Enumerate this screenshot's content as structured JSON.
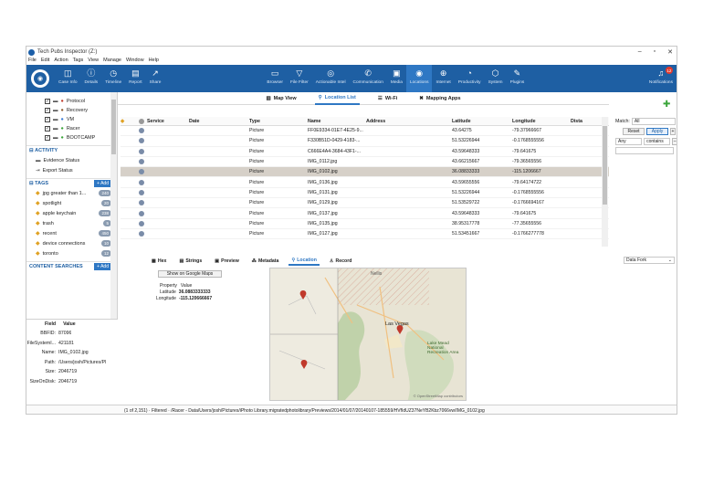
{
  "window": {
    "title": "Tech Pubs Inspector (Z:)"
  },
  "menu": [
    "File",
    "Edit",
    "Action",
    "Tags",
    "View",
    "Manage",
    "Window",
    "Help"
  ],
  "ribbon": {
    "left": [
      {
        "label": "Case Info",
        "icon": "case-info-icon",
        "glyph": "◫"
      },
      {
        "label": "Details",
        "icon": "details-icon",
        "glyph": "ⓘ"
      },
      {
        "label": "Timeline",
        "icon": "timeline-icon",
        "glyph": "◷"
      },
      {
        "label": "Report",
        "icon": "report-icon",
        "glyph": "▤"
      },
      {
        "label": "Share",
        "icon": "share-icon",
        "glyph": "↗"
      }
    ],
    "center": [
      {
        "label": "Browser",
        "icon": "browser-icon",
        "glyph": "▭"
      },
      {
        "label": "File Filter",
        "icon": "file-filter-icon",
        "glyph": "▽"
      },
      {
        "label": "Actionable Intel",
        "icon": "actionable-intel-icon",
        "glyph": "◎"
      },
      {
        "label": "Communication",
        "icon": "communication-icon",
        "glyph": "✆"
      },
      {
        "label": "Media",
        "icon": "media-icon",
        "glyph": "▣"
      },
      {
        "label": "Locations",
        "icon": "locations-icon",
        "glyph": "◉",
        "active": true
      },
      {
        "label": "Internet",
        "icon": "internet-icon",
        "glyph": "⊕"
      },
      {
        "label": "Productivity",
        "icon": "productivity-icon",
        "glyph": "◔"
      },
      {
        "label": "System",
        "icon": "system-icon",
        "glyph": "⬡"
      },
      {
        "label": "Plugins",
        "icon": "plugins-icon",
        "glyph": "✎"
      }
    ],
    "notifications": {
      "label": "Notifications",
      "count": "12"
    }
  },
  "left_tree": [
    {
      "label": "Protocol",
      "checked": true
    },
    {
      "label": "Recovery",
      "checked": true
    },
    {
      "label": "VM",
      "checked": true
    },
    {
      "label": "Racer",
      "checked": true
    },
    {
      "label": "BOOTCAMP",
      "checked": true
    }
  ],
  "activity": {
    "title": "ACTIVITY",
    "items": [
      "Evidence Status",
      "Export Status"
    ]
  },
  "tags": {
    "title": "TAGS",
    "add": "+ Add",
    "items": [
      {
        "label": "jpg greater than 1...",
        "count": "240"
      },
      {
        "label": "spotlight",
        "count": "20"
      },
      {
        "label": "apple keychain",
        "count": "238"
      },
      {
        "label": "trash",
        "count": "5"
      },
      {
        "label": "recent",
        "count": "450"
      },
      {
        "label": "device connections",
        "count": "10"
      },
      {
        "label": "toronto",
        "count": "12"
      }
    ]
  },
  "content_searches": {
    "title": "CONTENT SEARCHES",
    "add": "+ Add"
  },
  "props": {
    "headers": [
      "Field",
      "Value"
    ],
    "rows": [
      {
        "field": "BBFID:",
        "value": "87096"
      },
      {
        "field": "FileSystemI...",
        "value": "421181"
      },
      {
        "field": "Name:",
        "value": "IMG_0102.jpg"
      },
      {
        "field": "Path:",
        "value": "/Users/josh/Pictures/Pl"
      },
      {
        "field": "Size:",
        "value": "2046719"
      },
      {
        "field": "SizeOnDisk:",
        "value": "2046719"
      }
    ]
  },
  "view_tabs": [
    {
      "label": "Map View",
      "active": false
    },
    {
      "label": "Location List",
      "active": true
    },
    {
      "label": "Wi-Fi",
      "active": false
    },
    {
      "label": "Mapping Apps",
      "active": false
    }
  ],
  "grid": {
    "headers": [
      "Service",
      "Date",
      "Type",
      "Name",
      "Address",
      "Latitude",
      "Longitude",
      "Dista"
    ],
    "rows": [
      {
        "type": "Picture",
        "name": "FF0E9334-01E7-4E25-9...",
        "lat": "43.64275",
        "lon": "-79.37966667"
      },
      {
        "type": "Picture",
        "name": "F330B51D-0429-4183-...",
        "lat": "51.53226944",
        "lon": "-0.1768555556"
      },
      {
        "type": "Picture",
        "name": "C666E4A4-3684-43F1-...",
        "lat": "43.59648333",
        "lon": "-79.641675"
      },
      {
        "type": "Picture",
        "name": "IMG_0112.jpg",
        "lat": "43.66215667",
        "lon": "-79.36565556"
      },
      {
        "type": "Picture",
        "name": "IMG_0102.jpg",
        "lat": "36.08833333",
        "lon": "-115.1206667",
        "selected": true
      },
      {
        "type": "Picture",
        "name": "IMG_0136.jpg",
        "lat": "43.59655556",
        "lon": "-79.64174722"
      },
      {
        "type": "Picture",
        "name": "IMG_0131.jpg",
        "lat": "51.53226944",
        "lon": "-0.1768555556"
      },
      {
        "type": "Picture",
        "name": "IMG_0129.jpg",
        "lat": "51.53529722",
        "lon": "-0.1766694167"
      },
      {
        "type": "Picture",
        "name": "IMG_0137.jpg",
        "lat": "43.59648333",
        "lon": "-79.641675"
      },
      {
        "type": "Picture",
        "name": "IMG_0135.jpg",
        "lat": "38.95317778",
        "lon": "-77.35655556"
      },
      {
        "type": "Picture",
        "name": "IMG_0127.jpg",
        "lat": "51.53451667",
        "lon": "-0.1766277778"
      }
    ]
  },
  "filter": {
    "match_label": "Match:",
    "match_value": "All",
    "reset": "Reset",
    "apply": "Apply",
    "any": "Any",
    "contains": "contains"
  },
  "lower_tabs": [
    {
      "label": "Hex",
      "active": false
    },
    {
      "label": "Strings",
      "active": false
    },
    {
      "label": "Preview",
      "active": false
    },
    {
      "label": "Metadata",
      "active": false
    },
    {
      "label": "Location",
      "active": true
    },
    {
      "label": "Record",
      "active": false
    }
  ],
  "fork": "Data Fork",
  "location": {
    "show_button": "Show on Google Maps",
    "headers": [
      "Property",
      "Value"
    ],
    "latitude_label": "Latitude",
    "latitude": "36.0883333333",
    "longitude_label": "Longitude",
    "longitude": "-115.120666667"
  },
  "map_labels": {
    "city": "Las Vegas",
    "nellis": "Nellis",
    "lake_mead": "Lake Mead National Recreation Area",
    "attribution": "© OpenStreetMap contributors"
  },
  "status": "(1 of 2,151) · Filtered · /Racer - Data/Users/josh/Pictures/iPhoto Library.migratedphotolibrary/Previews/2014/01/07/20140107-185559/HVfIdUZ37NeYB2Kbz7066vw/IMG_0102.jpg",
  "colors": {
    "ribbon": "#1e5fa3",
    "accent": "#2f78c4",
    "selected_row": "#d6d0c8",
    "badge": "#e03a2e"
  }
}
